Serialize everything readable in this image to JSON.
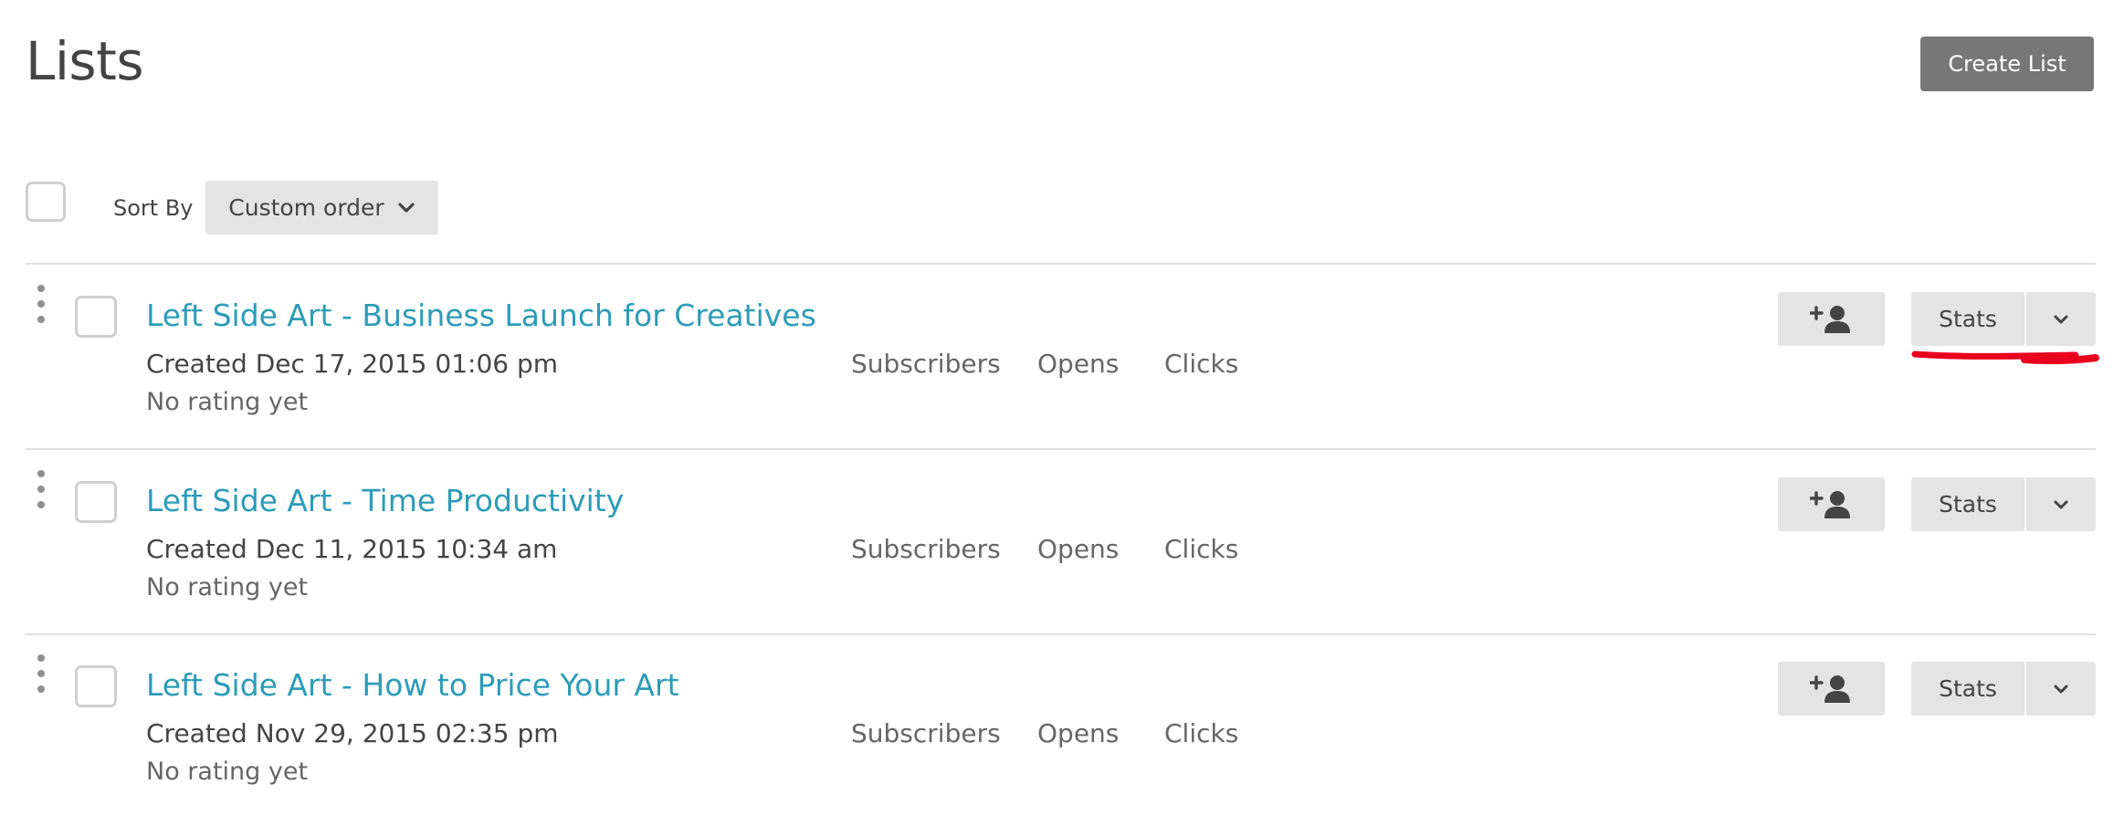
{
  "page": {
    "title": "Lists",
    "create_button": "Create List"
  },
  "toolbar": {
    "sort_label": "Sort By",
    "sort_value": "Custom order"
  },
  "columns": {
    "subscribers": "Subscribers",
    "opens": "Opens",
    "clicks": "Clicks"
  },
  "lists": [
    {
      "title": "Left Side Art - Business Launch for Creatives",
      "created": "Created Dec 17, 2015 01:06 pm",
      "rating": "No rating yet",
      "stats_label": "Stats"
    },
    {
      "title": "Left Side Art - Time Productivity",
      "created": "Created Dec 11, 2015 10:34 am",
      "rating": "No rating yet",
      "stats_label": "Stats"
    },
    {
      "title": "Left Side Art - How to Price Your Art",
      "created": "Created Nov 29, 2015 02:35 pm",
      "rating": "No rating yet",
      "stats_label": "Stats"
    }
  ],
  "icons": {
    "drag": "drag-handle-icon",
    "add_subscriber": "add-user-icon",
    "dropdown": "chevron-down-icon"
  },
  "colors": {
    "link": "#2d9cb8",
    "primary_button": "#777777",
    "secondary_button": "#e4e4e4",
    "annotation": "#e8001c"
  }
}
